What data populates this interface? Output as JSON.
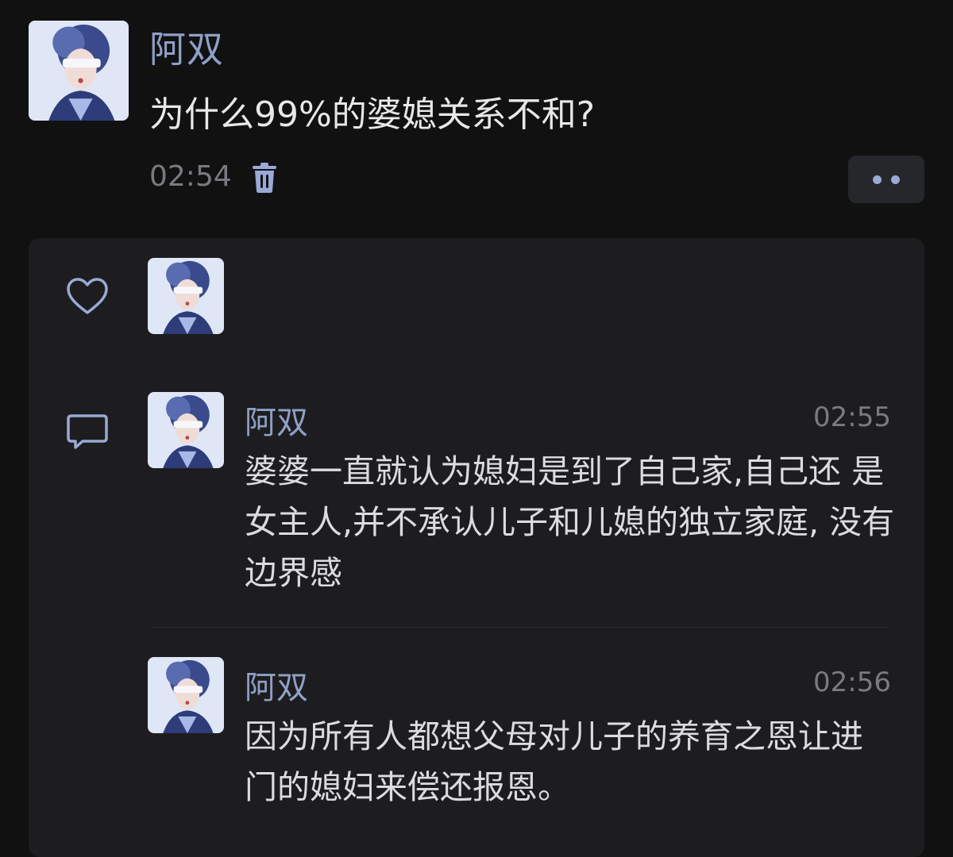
{
  "post": {
    "author": "阿双",
    "text": "为什么99%的婆媳关系不和?",
    "time": "02:54"
  },
  "icons": {
    "delete": "trash-icon",
    "more": "more-dots-icon",
    "like": "heart-icon",
    "comment": "comment-bubble-icon"
  },
  "colors": {
    "background": "#111112",
    "panel": "#1d1d1f",
    "name": "#8fa0c6",
    "text": "#dcdcde",
    "muted": "#7a7b80",
    "accent": "#9aa9d6"
  },
  "comments": [
    {
      "author": "阿双",
      "time": "02:55",
      "text": "婆婆一直就认为媳妇是到了自己家,自己还 是女主人,并不承认儿子和儿媳的独立家庭, 没有边界感"
    },
    {
      "author": "阿双",
      "time": "02:56",
      "text": "因为所有人都想父母对儿子的养育之恩让进 门的媳妇来偿还报恩。"
    }
  ]
}
